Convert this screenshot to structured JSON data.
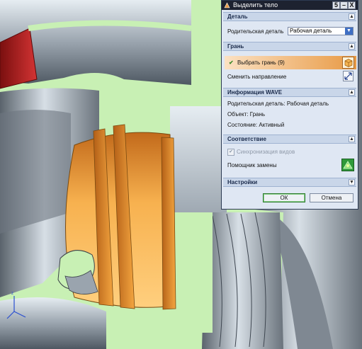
{
  "dialog": {
    "title": "Выделить тело",
    "title_buttons": [
      "5",
      "–",
      "X"
    ],
    "sections": {
      "detail": {
        "label": "Деталь",
        "parent_label": "Родительская деталь",
        "parent_value": "Рабочая деталь"
      },
      "face": {
        "label": "Грань",
        "select_face": "Выбрать грань (9)",
        "reverse_direction": "Сменить направление"
      },
      "wave_info": {
        "label": "Информация WAVE",
        "parent": "Родительская деталь: Рабочая деталь",
        "object": "Объект: Грань",
        "state": "Состояние: Активный"
      },
      "correspondence": {
        "label": "Соответствие",
        "sync_views": "Синхронизация видов",
        "sync_checked": true,
        "replace_assistant": "Помощник замены"
      },
      "settings": {
        "label": "Настройки"
      }
    },
    "ok_label": "ОК",
    "cancel_label": "Отмена"
  },
  "icons": {
    "checkmark": "checkmark-icon",
    "cube": "face-cube-icon",
    "reverse": "reverse-direction-icon",
    "assistant": "replace-assistant-icon",
    "triad": "axis-triad-icon"
  },
  "colors": {
    "background": "#c8f0b4",
    "body": "#9fa7b3",
    "selected_face": "#f0a040",
    "red_face": "#c22a2a"
  }
}
